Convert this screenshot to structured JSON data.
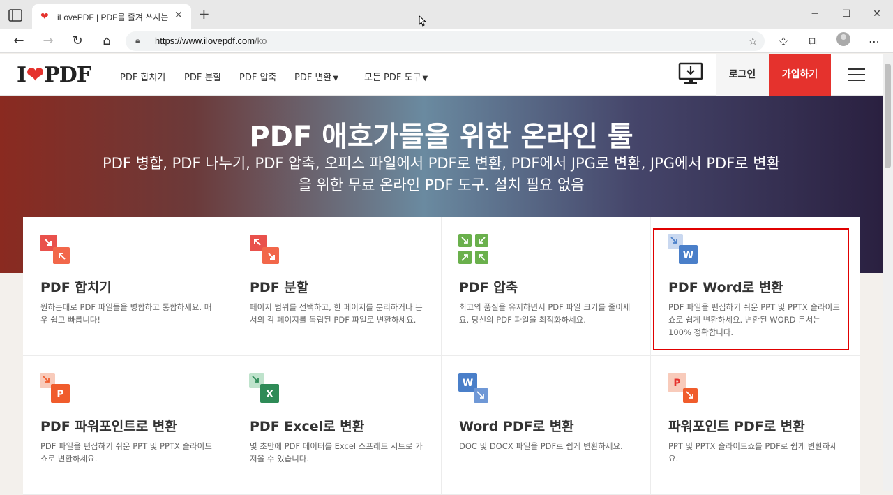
{
  "browser": {
    "tab_title": "iLovePDF | PDF를 즐겨 쓰시는 분",
    "tab_close": "✕",
    "new_tab": "+",
    "url_host": "https://www.ilovepdf.com",
    "url_path": "/ko"
  },
  "site": {
    "logo_left": "I",
    "logo_right": "PDF",
    "nav": [
      {
        "label": "PDF 합치기"
      },
      {
        "label": "PDF 분할"
      },
      {
        "label": "PDF 압축"
      },
      {
        "label": "PDF 변환",
        "dropdown": true
      },
      {
        "label": "모든 PDF 도구",
        "dropdown": true
      }
    ],
    "login": "로그인",
    "signup": "가입하기",
    "accent": "#e5322d"
  },
  "hero": {
    "title": "PDF 애호가들을 위한 온라인 툴",
    "subtitle": "PDF 병합, PDF 나누기, PDF 압축, 오피스 파일에서 PDF로 변환, PDF에서 JPG로 변환, JPG에서 PDF로 변환을 위한 무료 온라인 PDF 도구. 설치 필요 없음"
  },
  "tools": [
    {
      "title": "PDF 합치기",
      "desc": "원하는대로 PDF 파일들을 병합하고 통합하세요. 매우 쉽고 빠릅니다!",
      "icon": "merge-icon",
      "color": "#e5322d"
    },
    {
      "title": "PDF 분할",
      "desc": "페이지 범위를 선택하고, 한 페이지를 분리하거나 문서의 각 페이지를 독립된 PDF 파일로 변환하세요.",
      "icon": "split-icon",
      "color": "#e5322d"
    },
    {
      "title": "PDF 압축",
      "desc": "최고의 품질을 유지하면서 PDF 파일 크기를 줄이세요. 당신의 PDF 파일을 최적화하세요.",
      "icon": "compress-icon",
      "color": "#6ab04c"
    },
    {
      "title": "PDF Word로 변환",
      "desc": "PDF 파일을 편집하기 쉬운 PPT 및 PPTX 슬라이드쇼로 쉽게 변환하세요. 변환된 WORD 문서는 100% 정확합니다.",
      "icon": "pdf-to-word-icon",
      "letter": "W",
      "color": "#4a7fc9"
    },
    {
      "title": "PDF 파워포인트로 변환",
      "desc": "PDF 파일을 편집하기 쉬운 PPT 및 PPTX 슬라이드쇼로 변환하세요.",
      "icon": "pdf-to-powerpoint-icon",
      "letter": "P",
      "color": "#f05c2c"
    },
    {
      "title": "PDF Excel로 변환",
      "desc": "몇 초만에 PDF 데이터를 Excel 스프레드 시트로 가져올 수 있습니다.",
      "icon": "pdf-to-excel-icon",
      "letter": "X",
      "color": "#2e8b57"
    },
    {
      "title": "Word PDF로 변환",
      "desc": "DOC 및 DOCX 파일을 PDF로 쉽게 변환하세요.",
      "icon": "word-to-pdf-icon",
      "letter": "W",
      "color": "#4a7fc9"
    },
    {
      "title": "파워포인트 PDF로 변환",
      "desc": "PPT 및 PPTX 슬라이드쇼를 PDF로 쉽게 변환하세요.",
      "icon": "powerpoint-to-pdf-icon",
      "letter": "P",
      "color": "#f05c2c"
    }
  ]
}
